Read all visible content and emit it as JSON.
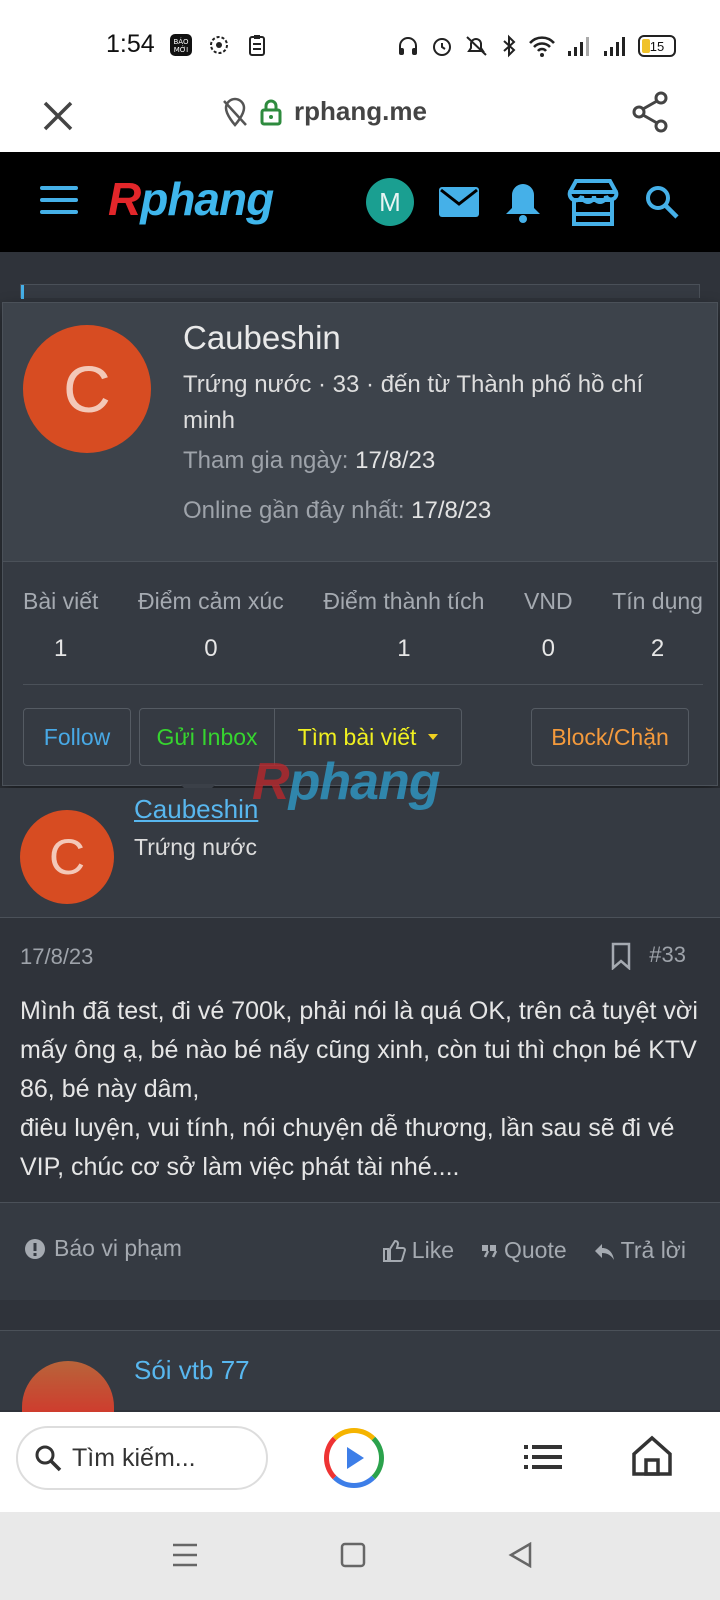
{
  "status_bar": {
    "time": "1:54",
    "battery": "15",
    "left_icons": [
      "bao-moi-icon",
      "settings-circle-icon",
      "clipboard-icon"
    ],
    "right_icons": [
      "headphones-icon",
      "alarm-icon",
      "mute-icon",
      "bluetooth-icon",
      "wifi-icon",
      "signal-icon",
      "signal-icon"
    ]
  },
  "url_bar": {
    "host": "rphang.me"
  },
  "site_header": {
    "logo": "Rphang",
    "user_initial": "M"
  },
  "profile_card": {
    "avatar_letter": "C",
    "username": "Caubeshin",
    "title_line": "Trứng nước · 33 · đến từ Thành phố hồ chí minh",
    "joined_label": "Tham gia ngày:",
    "joined_value": "17/8/23",
    "online_label": "Online gần đây nhất:",
    "online_value": "17/8/23",
    "stats": [
      {
        "label": "Bài viết",
        "value": "1"
      },
      {
        "label": "Điểm cảm xúc",
        "value": "0"
      },
      {
        "label": "Điểm thành tích",
        "value": "1"
      },
      {
        "label": "VND",
        "value": "0"
      },
      {
        "label": "Tín dụng",
        "value": "2"
      }
    ],
    "buttons": {
      "follow": "Follow",
      "inbox": "Gửi Inbox",
      "find": "Tìm bài viết",
      "block": "Block/Chặn"
    },
    "colors": {
      "follow": "#48a9e6",
      "inbox": "#36d52f",
      "find": "#f0f020",
      "block": "#f49a3c"
    }
  },
  "watermark": "Rphang",
  "post": {
    "author_letter": "C",
    "author_name": "Caubeshin",
    "author_title": "Trứng nước",
    "date": "17/8/23",
    "number": "#33",
    "body_lines": [
      "Mình đã test, đi vé 700k, phải nói là quá OK, trên cả tuyệt vời mấy ông ạ, bé nào bé nấy cũng xinh, còn tui thì chọn bé KTV 86, bé này dâm,",
      "điêu luyện, vui tính, nói chuyện dễ thương, lần sau sẽ đi vé VIP, chúc cơ sở làm việc phát tài nhé...."
    ],
    "report": "Báo vi phạm",
    "like": "Like",
    "quote": "Quote",
    "reply": "Trả lời"
  },
  "next_post": {
    "author_name": "Sói vtb 77"
  },
  "bottom_bar": {
    "search_placeholder": "Tìm kiếm..."
  }
}
